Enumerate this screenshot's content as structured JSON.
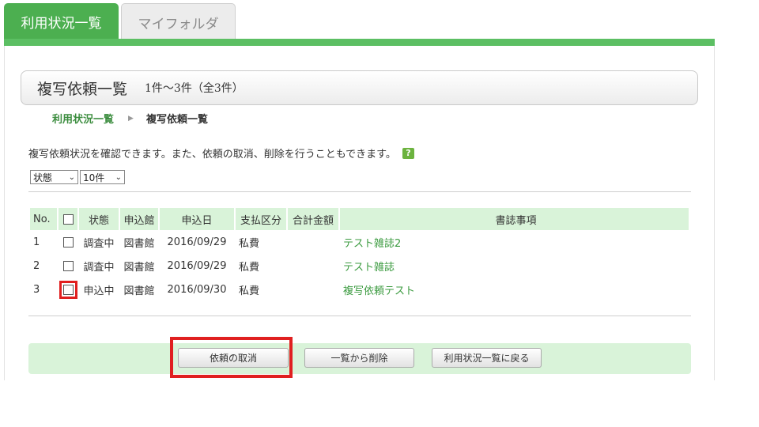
{
  "tabs": [
    {
      "label": "利用状況一覧",
      "active": true
    },
    {
      "label": "マイフォルダ",
      "active": false
    }
  ],
  "title": {
    "main": "複写依頼一覧",
    "count": "1件～3件（全3件）"
  },
  "breadcrumb": {
    "parent": "利用状況一覧",
    "separator": "▶",
    "current": "複写依頼一覧"
  },
  "description": "複写依頼状況を確認できます。また、依頼の取消、削除を行うこともできます。",
  "help_icon": "?",
  "filters": {
    "status": "状態",
    "per_page": "10件"
  },
  "table": {
    "headers": [
      "No.",
      "",
      "状態",
      "申込館",
      "申込日",
      "支払区分",
      "合計金額",
      "書誌事項"
    ],
    "rows": [
      {
        "no": "1",
        "status": "調査中",
        "library": "図書館",
        "date": "2016/09/29",
        "payment": "私費",
        "total": "",
        "bib": "テスト雑誌2"
      },
      {
        "no": "2",
        "status": "調査中",
        "library": "図書館",
        "date": "2016/09/29",
        "payment": "私費",
        "total": "",
        "bib": "テスト雑誌"
      },
      {
        "no": "3",
        "status": "申込中",
        "library": "図書館",
        "date": "2016/09/30",
        "payment": "私費",
        "total": "",
        "bib": "複写依頼テスト"
      }
    ]
  },
  "buttons": {
    "cancel": "依頼の取消",
    "delete": "一覧から削除",
    "back": "利用状況一覧に戻る"
  },
  "colors": {
    "accent": "#4caf50",
    "highlight": "#e02020",
    "row_bg": "#d9f3d9",
    "link": "#3c9b40"
  }
}
